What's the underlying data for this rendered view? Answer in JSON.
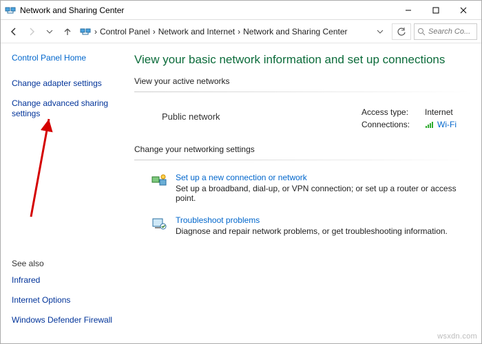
{
  "window": {
    "title": "Network and Sharing Center"
  },
  "breadcrumb": {
    "items": [
      "Control Panel",
      "Network and Internet",
      "Network and Sharing Center"
    ]
  },
  "search": {
    "placeholder": "Search Co..."
  },
  "sidebar": {
    "home": "Control Panel Home",
    "links": [
      "Change adapter settings",
      "Change advanced sharing settings"
    ],
    "see_also_heading": "See also",
    "see_also": [
      "Infrared",
      "Internet Options",
      "Windows Defender Firewall"
    ]
  },
  "main": {
    "heading": "View your basic network information and set up connections",
    "active_heading": "View your active networks",
    "network_name": "Public network",
    "access_label": "Access type:",
    "access_value": "Internet",
    "conn_label": "Connections:",
    "conn_value": "Wi-Fi",
    "change_heading": "Change your networking settings",
    "items": [
      {
        "link": "Set up a new connection or network",
        "desc": "Set up a broadband, dial-up, or VPN connection; or set up a router or access point."
      },
      {
        "link": "Troubleshoot problems",
        "desc": "Diagnose and repair network problems, or get troubleshooting information."
      }
    ]
  },
  "watermark": "wsxdn.com"
}
